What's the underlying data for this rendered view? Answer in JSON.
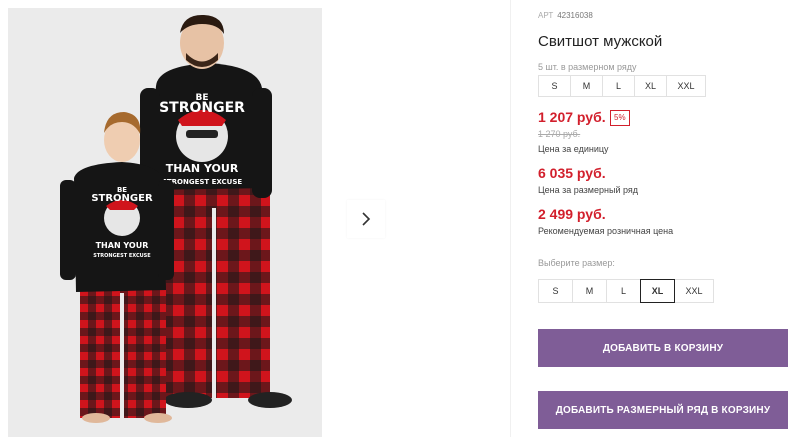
{
  "product": {
    "article_label": "АРТ",
    "article": "42316038",
    "title": "Свитшот мужской"
  },
  "pack": {
    "label": "5 шт. в размерном ряду",
    "sizes": [
      "S",
      "M",
      "L",
      "XL",
      "XXL"
    ]
  },
  "prices": {
    "unit_price": "1 207 руб.",
    "discount": "5%",
    "old_price": "1 270 руб.",
    "unit_caption": "Цена за единицу",
    "pack_price": "6 035 руб.",
    "pack_caption": "Цена за размерный ряд",
    "retail_price": "2 499 руб.",
    "retail_caption": "Рекомендуемая розничная цена"
  },
  "size_selector": {
    "label": "Выберите размер:",
    "options": [
      "S",
      "M",
      "L",
      "XL",
      "XXL"
    ],
    "selected": "XL"
  },
  "buttons": {
    "add_to_cart": "ДОБАВИТЬ В КОРЗИНУ",
    "add_pack_to_cart": "ДОБАВИТЬ РАЗМЕРНЫЙ РЯД В КОРЗИНУ"
  },
  "gallery": {
    "image_print_line1": "BE",
    "image_print_line2": "STRONGER",
    "image_print_line3": "THAN YOUR",
    "image_print_line4": "STRONGEST EXCUSE"
  },
  "colors": {
    "price_red": "#d21f2c",
    "button_purple": "#7f5d97",
    "pajama_red": "#d0141c",
    "sweatshirt_black": "#151515"
  }
}
